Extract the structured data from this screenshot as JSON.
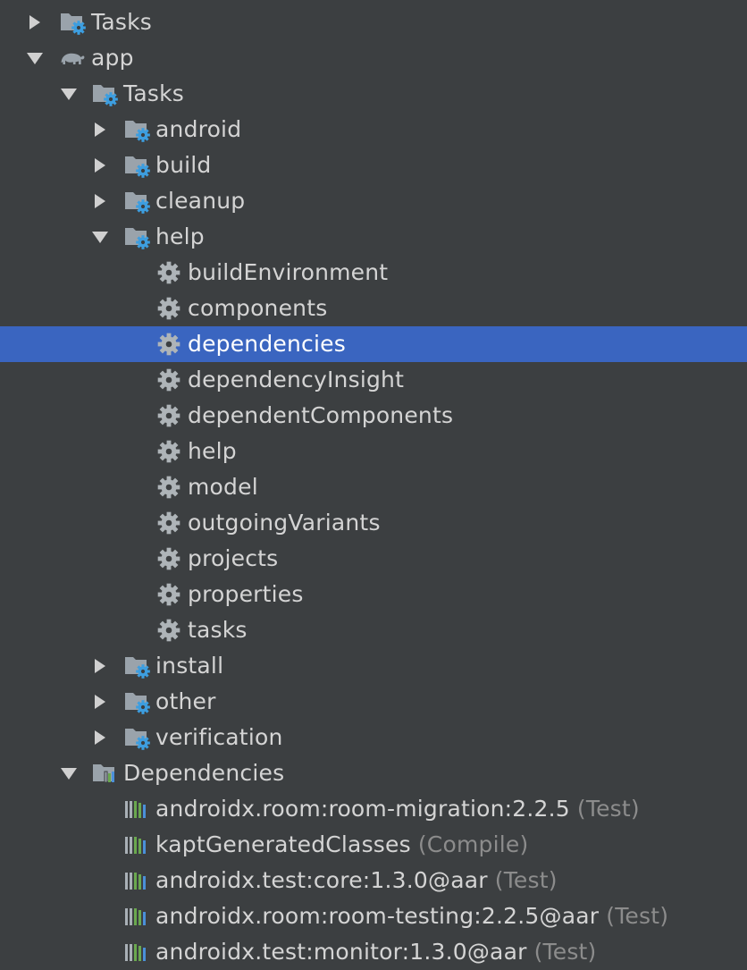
{
  "tree": [
    {
      "label": "Tasks",
      "icon": "folder-gear-icon",
      "arrow": "collapsed"
    },
    {
      "label": "app",
      "icon": "gradle-elephant-icon",
      "arrow": "expanded"
    },
    {
      "label": "Tasks",
      "icon": "folder-gear-icon",
      "arrow": "expanded"
    },
    {
      "label": "android",
      "icon": "folder-gear-icon",
      "arrow": "collapsed"
    },
    {
      "label": "build",
      "icon": "folder-gear-icon",
      "arrow": "collapsed"
    },
    {
      "label": "cleanup",
      "icon": "folder-gear-icon",
      "arrow": "collapsed"
    },
    {
      "label": "help",
      "icon": "folder-gear-icon",
      "arrow": "expanded"
    },
    {
      "label": "buildEnvironment",
      "icon": "gear-icon",
      "arrow": "none"
    },
    {
      "label": "components",
      "icon": "gear-icon",
      "arrow": "none"
    },
    {
      "label": "dependencies",
      "icon": "gear-icon",
      "arrow": "none",
      "selected": true
    },
    {
      "label": "dependencyInsight",
      "icon": "gear-icon",
      "arrow": "none"
    },
    {
      "label": "dependentComponents",
      "icon": "gear-icon",
      "arrow": "none"
    },
    {
      "label": "help",
      "icon": "gear-icon",
      "arrow": "none"
    },
    {
      "label": "model",
      "icon": "gear-icon",
      "arrow": "none"
    },
    {
      "label": "outgoingVariants",
      "icon": "gear-icon",
      "arrow": "none"
    },
    {
      "label": "projects",
      "icon": "gear-icon",
      "arrow": "none"
    },
    {
      "label": "properties",
      "icon": "gear-icon",
      "arrow": "none"
    },
    {
      "label": "tasks",
      "icon": "gear-icon",
      "arrow": "none"
    },
    {
      "label": "install",
      "icon": "folder-gear-icon",
      "arrow": "collapsed"
    },
    {
      "label": "other",
      "icon": "folder-gear-icon",
      "arrow": "collapsed"
    },
    {
      "label": "verification",
      "icon": "folder-gear-icon",
      "arrow": "collapsed"
    },
    {
      "label": "Dependencies",
      "icon": "folder-library-icon",
      "arrow": "expanded"
    },
    {
      "label": "androidx.room:room-migration:2.2.5",
      "scope": "(Test)",
      "icon": "library-icon",
      "arrow": "none"
    },
    {
      "label": "kaptGeneratedClasses",
      "scope": "(Compile)",
      "icon": "library-icon",
      "arrow": "none"
    },
    {
      "label": "androidx.test:core:1.3.0@aar",
      "scope": "(Test)",
      "icon": "library-icon",
      "arrow": "none"
    },
    {
      "label": "androidx.room:room-testing:2.2.5@aar",
      "scope": "(Test)",
      "icon": "library-icon",
      "arrow": "none"
    },
    {
      "label": "androidx.test:monitor:1.3.0@aar",
      "scope": "(Test)",
      "icon": "library-icon",
      "arrow": "none"
    }
  ],
  "colors": {
    "background": "#3c3f41",
    "selection": "#3a65c0",
    "text": "#d4d4d4",
    "scope_text": "#8c8c8c",
    "gear_accent": "#3d9ee0"
  }
}
